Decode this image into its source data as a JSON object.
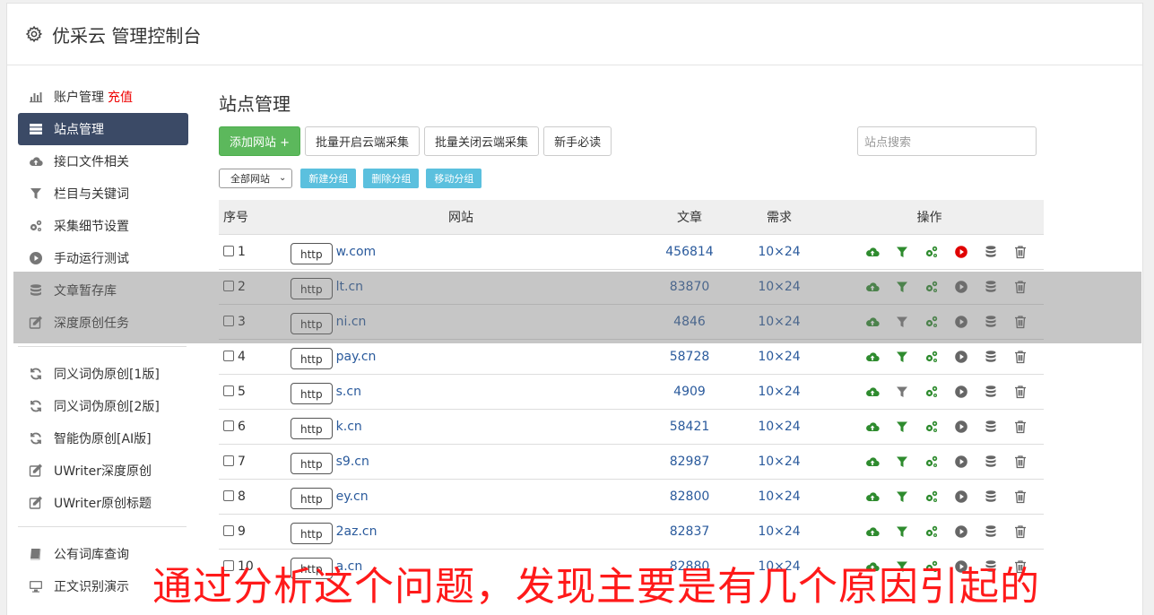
{
  "app": {
    "title": "优采云 管理控制台"
  },
  "sidebar": {
    "group1": [
      {
        "label": "账户管理",
        "accent": "充值",
        "icon": "bar-chart-icon"
      },
      {
        "label": "站点管理",
        "icon": "server-list-icon",
        "active": true
      },
      {
        "label": "接口文件相关",
        "icon": "cloud-upload-icon"
      },
      {
        "label": "栏目与关键词",
        "icon": "filter-icon"
      },
      {
        "label": "采集细节设置",
        "icon": "gears-icon"
      },
      {
        "label": "手动运行测试",
        "icon": "play-circle-icon"
      },
      {
        "label": "文章暂存库",
        "icon": "database-icon"
      },
      {
        "label": "深度原创任务",
        "icon": "edit-icon"
      }
    ],
    "group2": [
      {
        "label": "同义词伪原创[1版]",
        "icon": "refresh-icon"
      },
      {
        "label": "同义词伪原创[2版]",
        "icon": "refresh-icon"
      },
      {
        "label": "智能伪原创[AI版]",
        "icon": "refresh-icon"
      },
      {
        "label": "UWriter深度原创",
        "icon": "edit-icon"
      },
      {
        "label": "UWriter原创标题",
        "icon": "edit-icon"
      }
    ],
    "group3": [
      {
        "label": "公有词库查询",
        "icon": "book-icon"
      },
      {
        "label": "正文识别演示",
        "icon": "monitor-icon"
      }
    ]
  },
  "main": {
    "title": "站点管理",
    "toolbar": {
      "add": "添加网站 +",
      "batch_on": "批量开启云端采集",
      "batch_off": "批量关闭云端采集",
      "guide": "新手必读",
      "search_placeholder": "站点搜索"
    },
    "group_select": "全部网站",
    "group_buttons": [
      "新建分组",
      "删除分组",
      "移动分组"
    ],
    "table": {
      "headers": {
        "no": "序号",
        "site": "网站",
        "articles": "文章",
        "demand": "需求",
        "ops": "操作"
      },
      "http_label": "http",
      "rows": [
        {
          "no": "1",
          "domain": "w.com",
          "articles": "456814",
          "demand": "10×24",
          "run_active": true,
          "filter_active": true
        },
        {
          "no": "2",
          "domain": "lt.cn",
          "articles": "83870",
          "demand": "10×24",
          "run_active": false,
          "filter_active": true
        },
        {
          "no": "3",
          "domain": "ni.cn",
          "articles": "4846",
          "demand": "10×24",
          "run_active": false,
          "filter_active": false
        },
        {
          "no": "4",
          "domain": "pay.cn",
          "articles": "58728",
          "demand": "10×24",
          "run_active": false,
          "filter_active": true
        },
        {
          "no": "5",
          "domain": "s.cn",
          "articles": "4909",
          "demand": "10×24",
          "run_active": false,
          "filter_active": false
        },
        {
          "no": "6",
          "domain": "k.cn",
          "articles": "58421",
          "demand": "10×24",
          "run_active": false,
          "filter_active": true
        },
        {
          "no": "7",
          "domain": "s9.cn",
          "articles": "82987",
          "demand": "10×24",
          "run_active": false,
          "filter_active": true
        },
        {
          "no": "8",
          "domain": "ey.cn",
          "articles": "82800",
          "demand": "10×24",
          "run_active": false,
          "filter_active": true
        },
        {
          "no": "9",
          "domain": "2az.cn",
          "articles": "82837",
          "demand": "10×24",
          "run_active": false,
          "filter_active": true
        },
        {
          "no": "10",
          "domain": "a.cn",
          "articles": "82880",
          "demand": "10×24",
          "run_active": false,
          "filter_active": true
        }
      ]
    }
  },
  "caption": "通过分析这个问题，发现主要是有几个原因引起的",
  "colors": {
    "accent_red": "#e00000",
    "link_blue": "#2a5a9c",
    "green": "#2e8b2e",
    "active_nav": "#3b4a66",
    "info_btn": "#5bc0de",
    "success_btn": "#5cb85c"
  }
}
